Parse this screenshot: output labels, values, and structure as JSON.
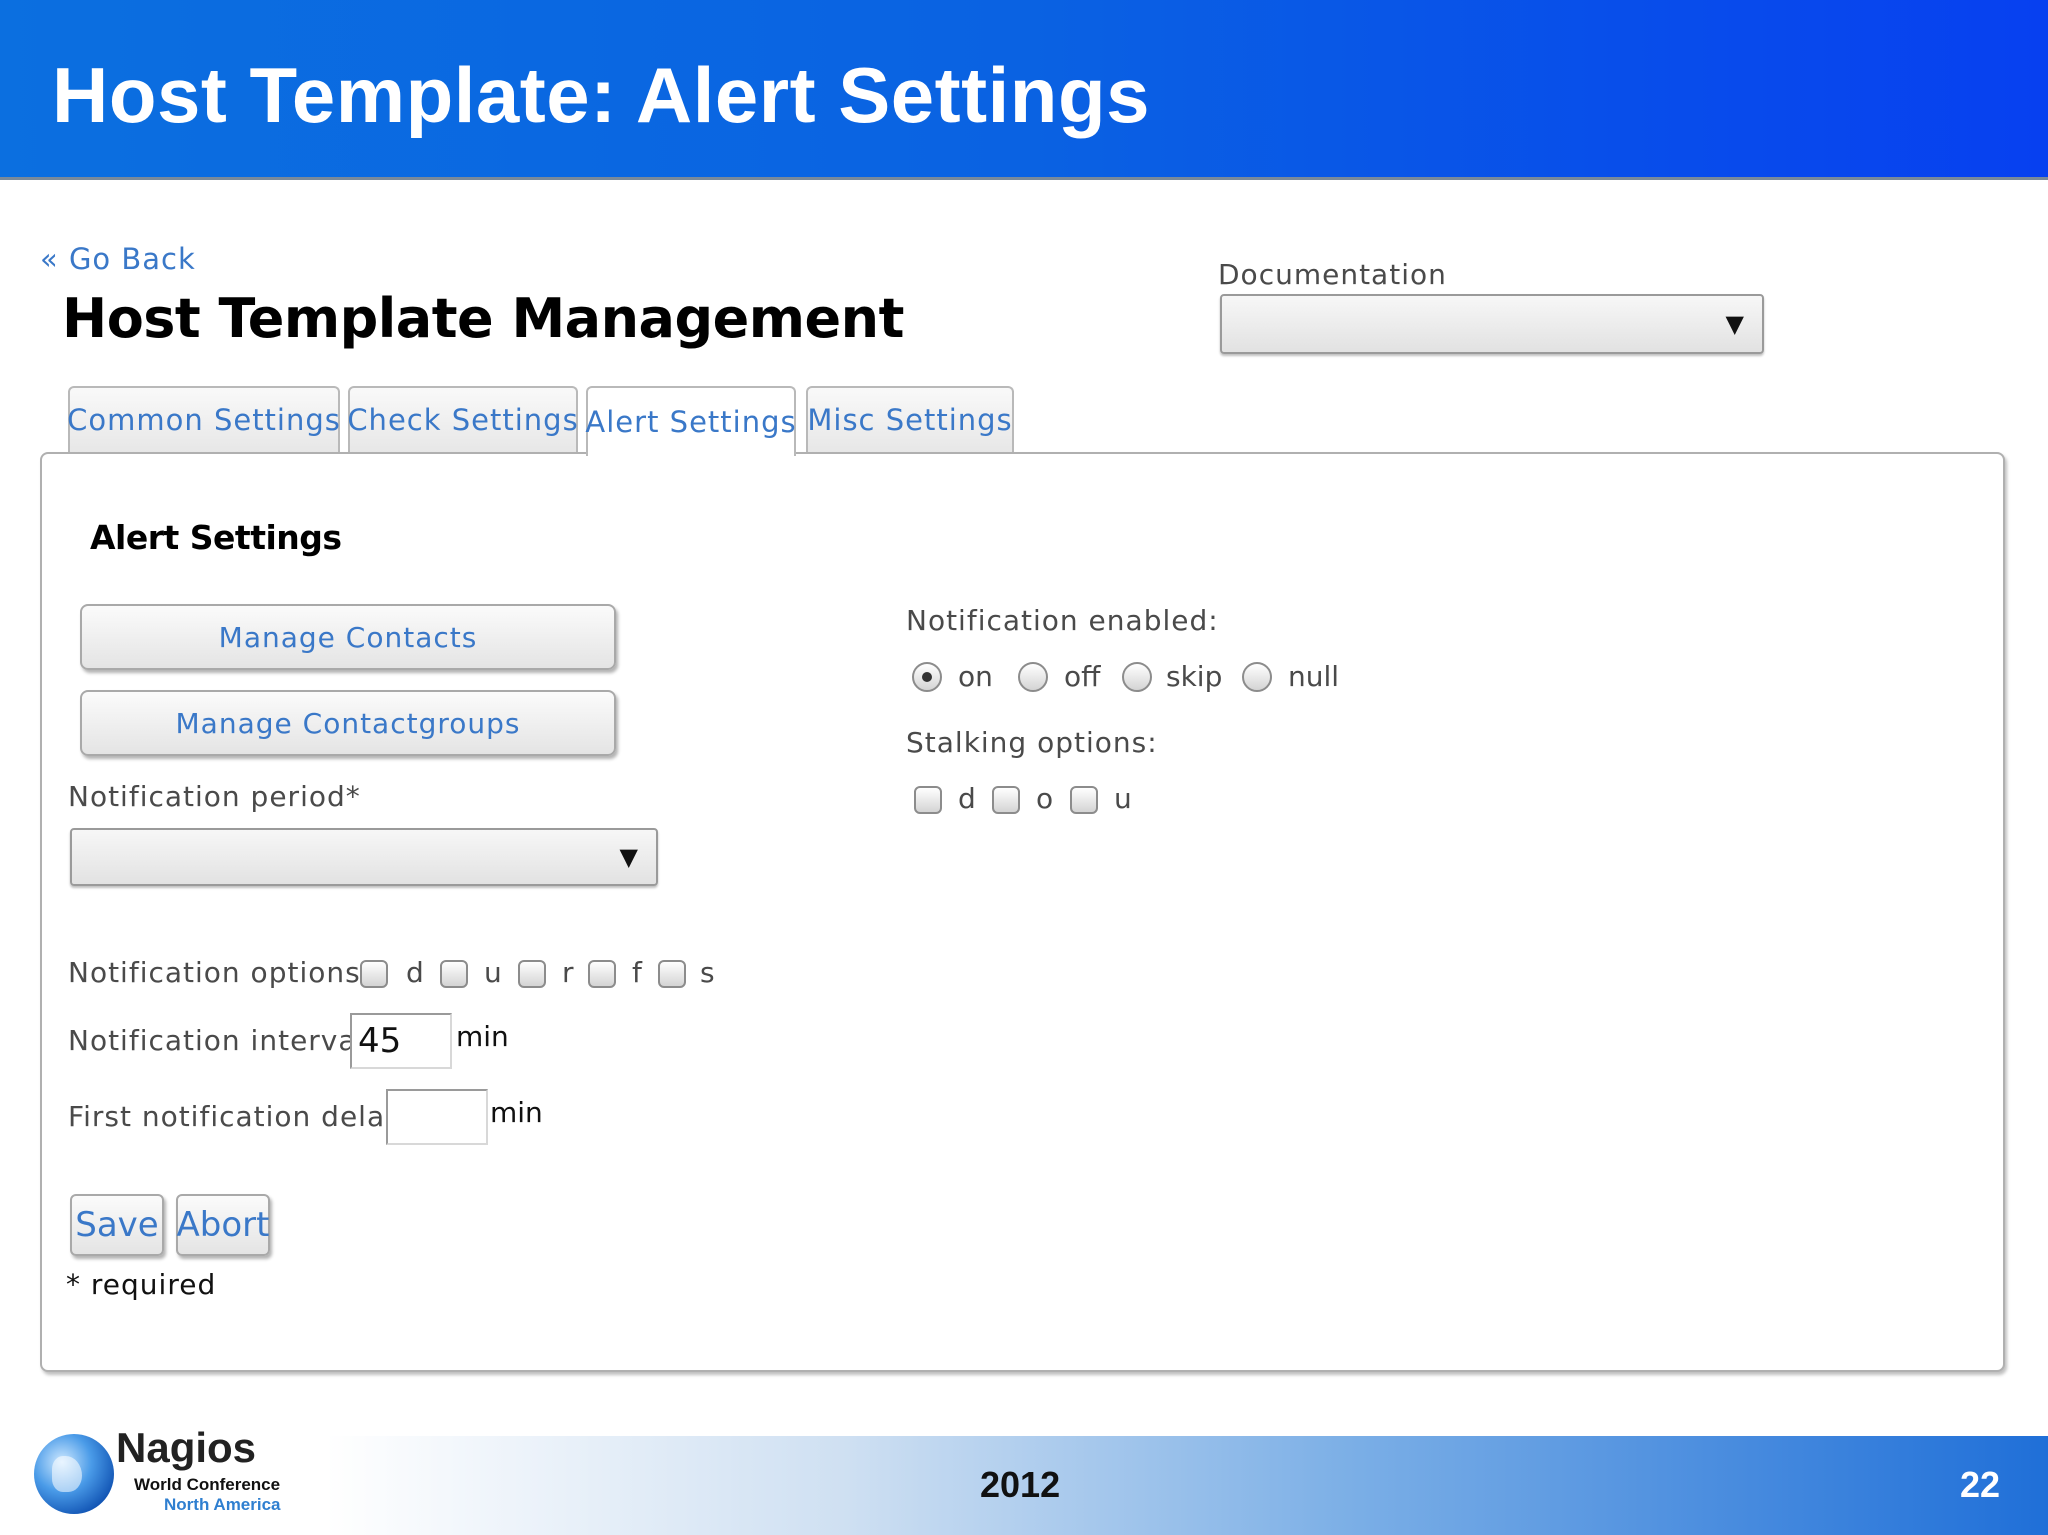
{
  "slide": {
    "title": "Host Template: Alert Settings",
    "footer_year": "2012",
    "page_number": "22",
    "logo": {
      "name": "Nagios",
      "line1": "World Conference",
      "line2": "North America"
    }
  },
  "app": {
    "go_back": "« Go Back",
    "title": "Host Template Management",
    "documentation_label": "Documentation",
    "documentation_value": ""
  },
  "tabs": [
    {
      "label": "Common Settings",
      "active": false
    },
    {
      "label": "Check Settings",
      "active": false
    },
    {
      "label": "Alert Settings",
      "active": true
    },
    {
      "label": "Misc Settings",
      "active": false
    }
  ],
  "panel": {
    "section_title": "Alert Settings",
    "manage_contacts": "Manage Contacts",
    "manage_contactgroups": "Manage Contactgroups",
    "notification_period_label": "Notification period*",
    "notification_period_value": "",
    "notification_options_label": "Notification options:",
    "notification_options": [
      "d",
      "u",
      "r",
      "f",
      "s"
    ],
    "notification_interval_label": "Notification interval",
    "notification_interval_value": "45",
    "first_delay_label": "First notification delay",
    "first_delay_value": "",
    "unit": "min",
    "notification_enabled_label": "Notification enabled:",
    "notification_enabled_options": [
      "on",
      "off",
      "skip",
      "null"
    ],
    "notification_enabled_selected": "on",
    "stalking_label": "Stalking options:",
    "stalking_options": [
      "d",
      "o",
      "u"
    ],
    "save": "Save",
    "abort": "Abort",
    "required_note": "* required"
  },
  "icons": {
    "dropdown": "triangle-down-icon",
    "globe": "globe-icon"
  },
  "colors": {
    "header_blue": "#0a62e2",
    "link_blue": "#3a78c8"
  }
}
